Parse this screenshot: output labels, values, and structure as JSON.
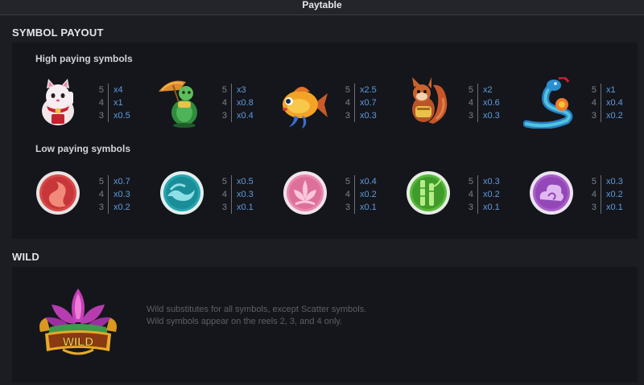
{
  "header": {
    "title": "Paytable"
  },
  "sections": {
    "symbol_payout": "SYMBOL PAYOUT",
    "high_label": "High paying symbols",
    "low_label": "Low paying symbols",
    "wild": "WILD"
  },
  "high_symbols": [
    {
      "icon": "lucky-cat-icon",
      "payouts": [
        {
          "count": "5",
          "mult": "x4"
        },
        {
          "count": "4",
          "mult": "x1"
        },
        {
          "count": "3",
          "mult": "x0.5"
        }
      ]
    },
    {
      "icon": "turtle-icon",
      "payouts": [
        {
          "count": "5",
          "mult": "x3"
        },
        {
          "count": "4",
          "mult": "x0.8"
        },
        {
          "count": "3",
          "mult": "x0.4"
        }
      ]
    },
    {
      "icon": "goldfish-icon",
      "payouts": [
        {
          "count": "5",
          "mult": "x2.5"
        },
        {
          "count": "4",
          "mult": "x0.7"
        },
        {
          "count": "3",
          "mult": "x0.3"
        }
      ]
    },
    {
      "icon": "squirrel-icon",
      "payouts": [
        {
          "count": "5",
          "mult": "x2"
        },
        {
          "count": "4",
          "mult": "x0.6"
        },
        {
          "count": "3",
          "mult": "x0.3"
        }
      ]
    },
    {
      "icon": "snake-icon",
      "payouts": [
        {
          "count": "5",
          "mult": "x1"
        },
        {
          "count": "4",
          "mult": "x0.4"
        },
        {
          "count": "3",
          "mult": "x0.2"
        }
      ]
    }
  ],
  "low_symbols": [
    {
      "icon": "red-flame-coin-icon",
      "payouts": [
        {
          "count": "5",
          "mult": "x0.7"
        },
        {
          "count": "4",
          "mult": "x0.3"
        },
        {
          "count": "3",
          "mult": "x0.2"
        }
      ]
    },
    {
      "icon": "teal-wave-coin-icon",
      "payouts": [
        {
          "count": "5",
          "mult": "x0.5"
        },
        {
          "count": "4",
          "mult": "x0.3"
        },
        {
          "count": "3",
          "mult": "x0.1"
        }
      ]
    },
    {
      "icon": "pink-lotus-coin-icon",
      "payouts": [
        {
          "count": "5",
          "mult": "x0.4"
        },
        {
          "count": "4",
          "mult": "x0.2"
        },
        {
          "count": "3",
          "mult": "x0.1"
        }
      ]
    },
    {
      "icon": "green-bamboo-coin-icon",
      "payouts": [
        {
          "count": "5",
          "mult": "x0.3"
        },
        {
          "count": "4",
          "mult": "x0.2"
        },
        {
          "count": "3",
          "mult": "x0.1"
        }
      ]
    },
    {
      "icon": "purple-cloud-coin-icon",
      "payouts": [
        {
          "count": "5",
          "mult": "x0.3"
        },
        {
          "count": "4",
          "mult": "x0.2"
        },
        {
          "count": "3",
          "mult": "x0.1"
        }
      ]
    }
  ],
  "wild": {
    "badge_text": "WILD",
    "icon": "wild-lotus-icon",
    "description": [
      "Wild substitutes for all symbols, except Scatter symbols.",
      "Wild symbols appear on the reels 2, 3, and 4 only."
    ]
  },
  "colors": {
    "background": "#1c1d22",
    "panel": "#14161b",
    "payout_value": "#5f9be0"
  }
}
